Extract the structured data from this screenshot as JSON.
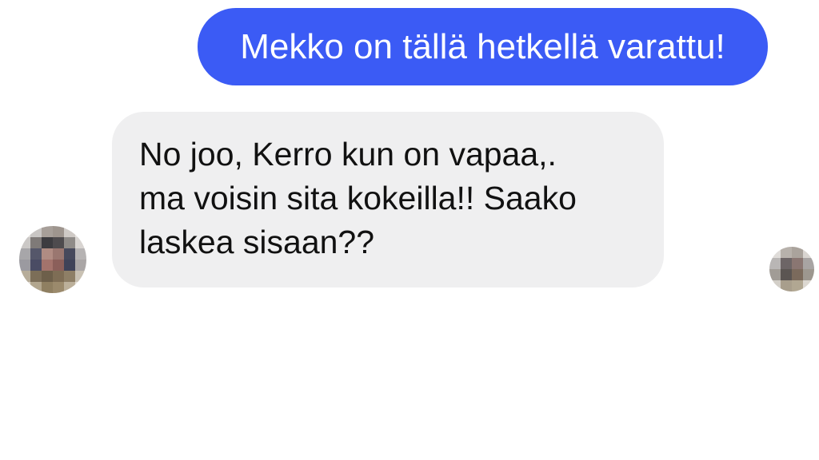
{
  "conversation": {
    "outgoing_message": {
      "text": "Mekko on tällä hetkellä varattu!",
      "bubble_color": "#3b5bf5",
      "text_color": "#ffffff"
    },
    "incoming_message": {
      "lines": [
        "No joo, Kerro kun on vapaa,.",
        "ma voisin sita kokeilla!! Saako",
        "laskea sisaan??"
      ],
      "bubble_color": "#efeff0",
      "text_color": "#111111"
    },
    "avatars": {
      "sender_avatar_icon": "pixelated-avatar-icon",
      "read_receipt_avatar_icon": "pixelated-avatar-icon"
    }
  }
}
